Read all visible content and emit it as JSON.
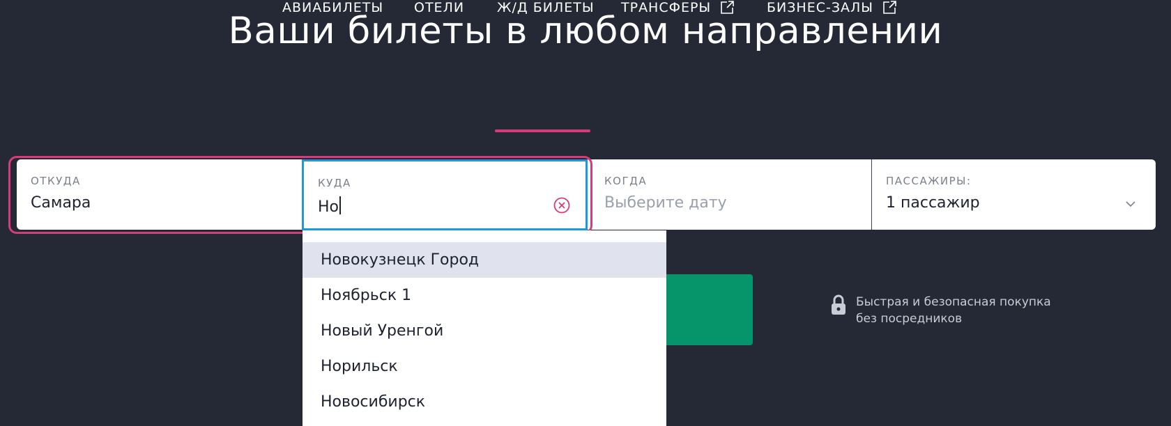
{
  "page_title": "Ваши билеты в любом направлении",
  "tabs": [
    {
      "label": "АВИАБИЛЕТЫ",
      "external": false
    },
    {
      "label": "ОТЕЛИ",
      "external": false
    },
    {
      "label": "Ж/Д БИЛЕТЫ",
      "external": false,
      "active": true
    },
    {
      "label": "ТРАНСФЕРЫ",
      "external": true
    },
    {
      "label": "БИЗНЕС-ЗАЛЫ",
      "external": true
    }
  ],
  "search": {
    "from": {
      "label": "ОТКУДА",
      "value": "Самара"
    },
    "to": {
      "label": "КУДА",
      "value": "Но"
    },
    "when": {
      "label": "КОГДА",
      "placeholder": "Выберите дату"
    },
    "passengers": {
      "label": "ПАССАЖИРЫ:",
      "value": "1 пассажир"
    }
  },
  "suggestions": [
    "Новокузнецк Город",
    "Ноябрьск 1",
    "Новый Уренгой",
    "Норильск",
    "Новосибирск"
  ],
  "secure_note": {
    "line1": "Быстрая и безопасная покупка",
    "line2": "без посредников"
  },
  "colors": {
    "background": "#252935",
    "accent": "#d63c7a",
    "focus": "#1f98d9",
    "button": "#06946a"
  },
  "icons": {
    "external_link": "external-link-icon",
    "clear": "clear-icon",
    "chevron": "chevron-down-icon",
    "lock": "lock-icon"
  }
}
